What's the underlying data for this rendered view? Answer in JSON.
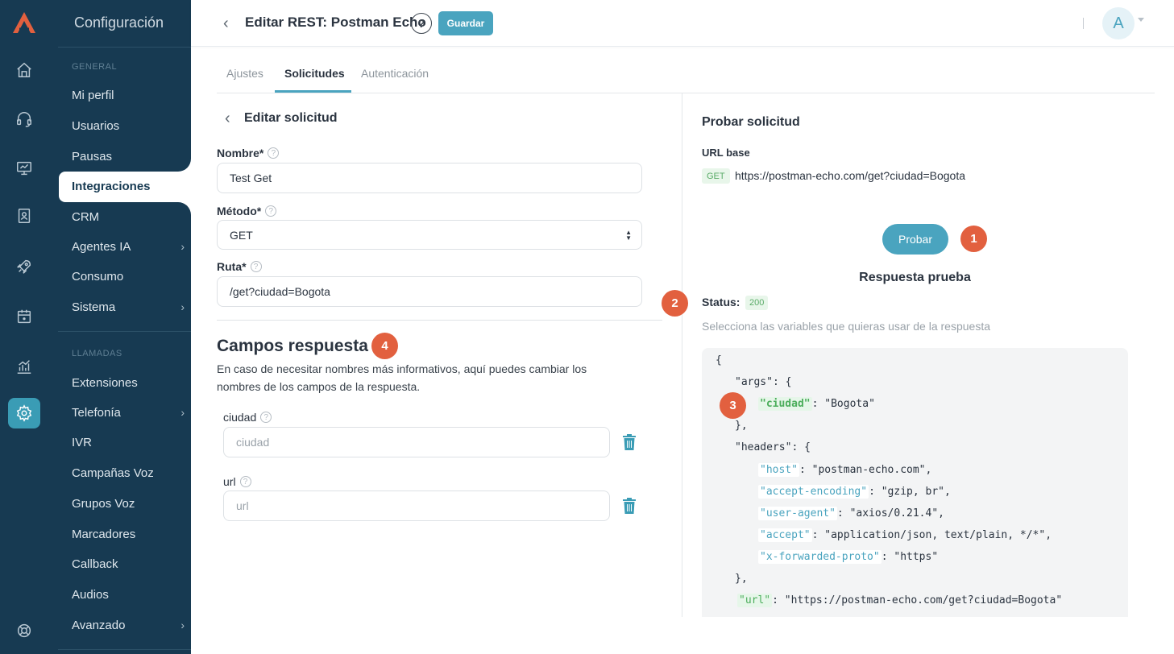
{
  "sidebar": {
    "title": "Configuración",
    "sections": {
      "general": "GENERAL",
      "llamadas": "LLAMADAS"
    },
    "items": [
      {
        "label": "Mi perfil"
      },
      {
        "label": "Usuarios"
      },
      {
        "label": "Pausas"
      },
      {
        "label": "Integraciones",
        "active": true
      },
      {
        "label": "CRM"
      },
      {
        "label": "Agentes IA",
        "chevron": "›"
      },
      {
        "label": "Consumo"
      },
      {
        "label": "Sistema",
        "chevron": "›"
      },
      {
        "label": "Extensiones"
      },
      {
        "label": "Telefonía",
        "chevron": "›"
      },
      {
        "label": "IVR"
      },
      {
        "label": "Campañas Voz"
      },
      {
        "label": "Grupos Voz"
      },
      {
        "label": "Marcadores"
      },
      {
        "label": "Callback"
      },
      {
        "label": "Audios"
      },
      {
        "label": "Avanzado",
        "chevron": "›"
      }
    ]
  },
  "rail": {
    "icons": [
      "home-icon",
      "headset-icon",
      "monitor-icon",
      "contact-book-icon",
      "rocket-icon",
      "calendar-icon",
      "analytics-icon",
      "gear-icon",
      "lifebuoy-icon"
    ],
    "active": "gear-icon",
    "logo_color": "#e2603f"
  },
  "header": {
    "back": "‹",
    "title": "Editar REST: Postman Echo",
    "help": "?",
    "save_label": "Guardar",
    "avatar_initial": "A"
  },
  "tabs": [
    {
      "label": "Ajustes"
    },
    {
      "label": "Solicitudes",
      "active": true
    },
    {
      "label": "Autenticación"
    }
  ],
  "form": {
    "back": "‹",
    "title": "Editar solicitud",
    "name_label": "Nombre*",
    "name_value": "Test Get",
    "method_label": "Método*",
    "method_value": "GET",
    "path_label": "Ruta*",
    "path_value": "/get?ciudad=Bogota"
  },
  "response_fields": {
    "title": "Campos respuesta",
    "description": "En caso de necesitar nombres más informativos, aquí puedes cambiar los nombres de los campos de la respuesta.",
    "fields": [
      {
        "label": "ciudad",
        "placeholder": "ciudad"
      },
      {
        "label": "url",
        "placeholder": "url"
      }
    ]
  },
  "test_panel": {
    "title": "Probar solicitud",
    "base_url_label": "URL base",
    "method_tag": "GET",
    "base_url": "https://postman-echo.com/get?ciudad=Bogota",
    "test_button": "Probar",
    "response_title": "Respuesta prueba",
    "status_label": "Status:",
    "status_value": "200",
    "hint": "Selecciona las variables que quieras usar de la respuesta"
  },
  "json_lines": [
    {
      "indent": 0,
      "text": "{"
    },
    {
      "indent": 1,
      "plain": "\"args\": {"
    },
    {
      "indent": 2,
      "key": "\"ciudad\"",
      "value": ": \"Bogota\"",
      "selected": true
    },
    {
      "indent": 1,
      "text": "},"
    },
    {
      "indent": 1,
      "plain": "\"headers\": {"
    },
    {
      "indent": 2,
      "key": "\"host\"",
      "value": ": \"postman-echo.com\","
    },
    {
      "indent": 2,
      "key": "\"accept-encoding\"",
      "value": ": \"gzip, br\","
    },
    {
      "indent": 2,
      "key": "\"user-agent\"",
      "value": ": \"axios/0.21.4\","
    },
    {
      "indent": 2,
      "key": "\"accept\"",
      "value": ": \"application/json, text/plain, */*\","
    },
    {
      "indent": 2,
      "key": "\"x-forwarded-proto\"",
      "value": ": \"https\""
    },
    {
      "indent": 1,
      "text": "},"
    },
    {
      "indent": 1,
      "key": "\"url\"",
      "value": ": \"https://postman-echo.com/get?ciudad=Bogota\"",
      "url": true
    }
  ],
  "badges": [
    "1",
    "2",
    "3",
    "4"
  ],
  "colors": {
    "accent": "#4aa4bf",
    "sidebar": "#173a52",
    "badge": "#e2603f",
    "success": "#5aab68"
  }
}
